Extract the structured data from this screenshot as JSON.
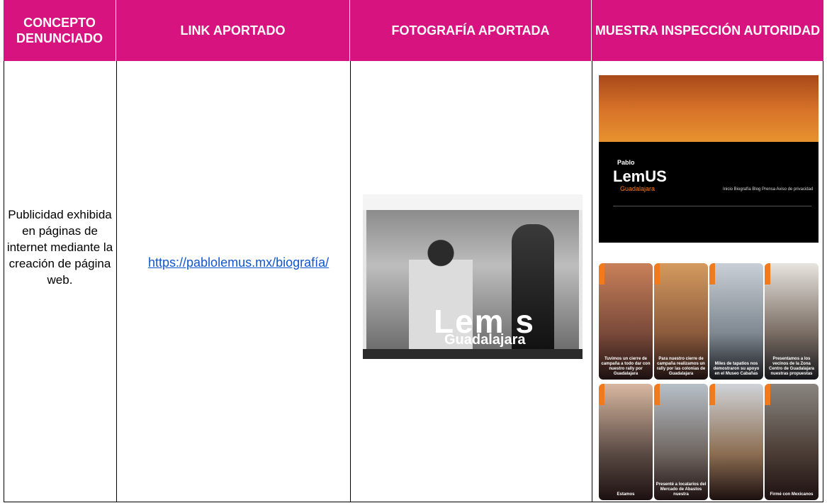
{
  "headers": {
    "concepto": "CONCEPTO DENUNCIADO",
    "link": "LINK APORTADO",
    "foto": "FOTOGRAFÍA APORTADA",
    "muestra": "MUESTRA INSPECCIÓN AUTORIDAD"
  },
  "row": {
    "concepto": "Publicidad exhibida en páginas de internet mediante la creación de página web.",
    "link": "https://pablolemus.mx/biografía/"
  },
  "photo": {
    "lemus": "Lem  s",
    "city": "Guadalajara"
  },
  "inspection": {
    "name": "Pablo",
    "lemus": "LemUS",
    "city": "Guadalajara",
    "nav": "Inicio  Biografía  Blog  Prensa  Aviso de privacidad",
    "tiles": [
      {
        "caption": "Tuvimos un cierre de campaña a todo dar con nuestro rally por Guadalajara"
      },
      {
        "caption": "Para nuestro cierre de campaña realizamos un rally por las colonias de Guadalajara"
      },
      {
        "caption": "Miles de tapatíos nos demostraron su apoyo en el Museo Cabañas"
      },
      {
        "caption": "Presentamos a los vecinos de la Zona Centro de Guadalajara nuestras propuestas"
      },
      {
        "caption": "Estamos"
      },
      {
        "caption": "Presenté a locatarios del Mercado de Abastos nuestra"
      },
      {
        "caption": ""
      },
      {
        "caption": "Firmé con Mexicanos"
      }
    ]
  },
  "colors": {
    "header_bg": "#d6137e",
    "link": "#1155cc"
  }
}
